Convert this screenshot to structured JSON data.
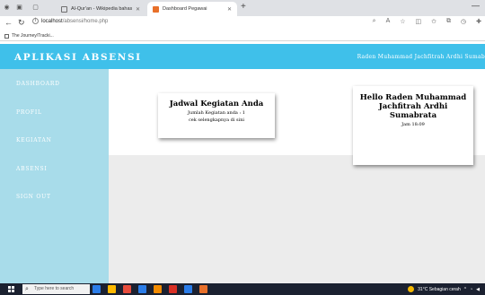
{
  "browser": {
    "tabs": [
      {
        "title": "Al-Qur'an - Wikipedia bahasa In",
        "active": false,
        "favicon_color": "#6f6f6f"
      },
      {
        "title": "Dashboard Pegawai",
        "active": true,
        "favicon_color": "#e8702a"
      }
    ],
    "url_host": "localhost",
    "url_path": "/absensi/home.php",
    "bookmark": "The Journey/Tracki..."
  },
  "app": {
    "title": "APLIKASI ABSENSI",
    "user_name": "Raden Muhammad Jachfitrah Ardhi Sumab",
    "header_color": "#3fc0ea",
    "sidebar_color": "#a8dcea"
  },
  "sidebar": {
    "items": [
      {
        "label": "DASHBOARD"
      },
      {
        "label": "PROFIL"
      },
      {
        "label": "KEGIATAN"
      },
      {
        "label": "ABSENSI"
      },
      {
        "label": "SIGN OUT"
      }
    ]
  },
  "cards": {
    "schedule": {
      "title": "Jadwal Kegiatan Anda",
      "line1": "Jumlah Kegiatan anda : 1",
      "line2": "cek selengkapnya di sini"
    },
    "greeting": {
      "title": "Hello Raden Muhammad Jachfitrah Ardhi Sumabrata",
      "clock": "Jam 18:09"
    }
  },
  "taskbar": {
    "search_placeholder": "Type here to search",
    "weather": "31°C Sebagian cerah",
    "app_colors": [
      "#2b7de9",
      "#ffb900",
      "#e74c3c",
      "#2b7de9",
      "#f28b00",
      "#d93025",
      "#2b7de9",
      "#e8702a"
    ]
  }
}
